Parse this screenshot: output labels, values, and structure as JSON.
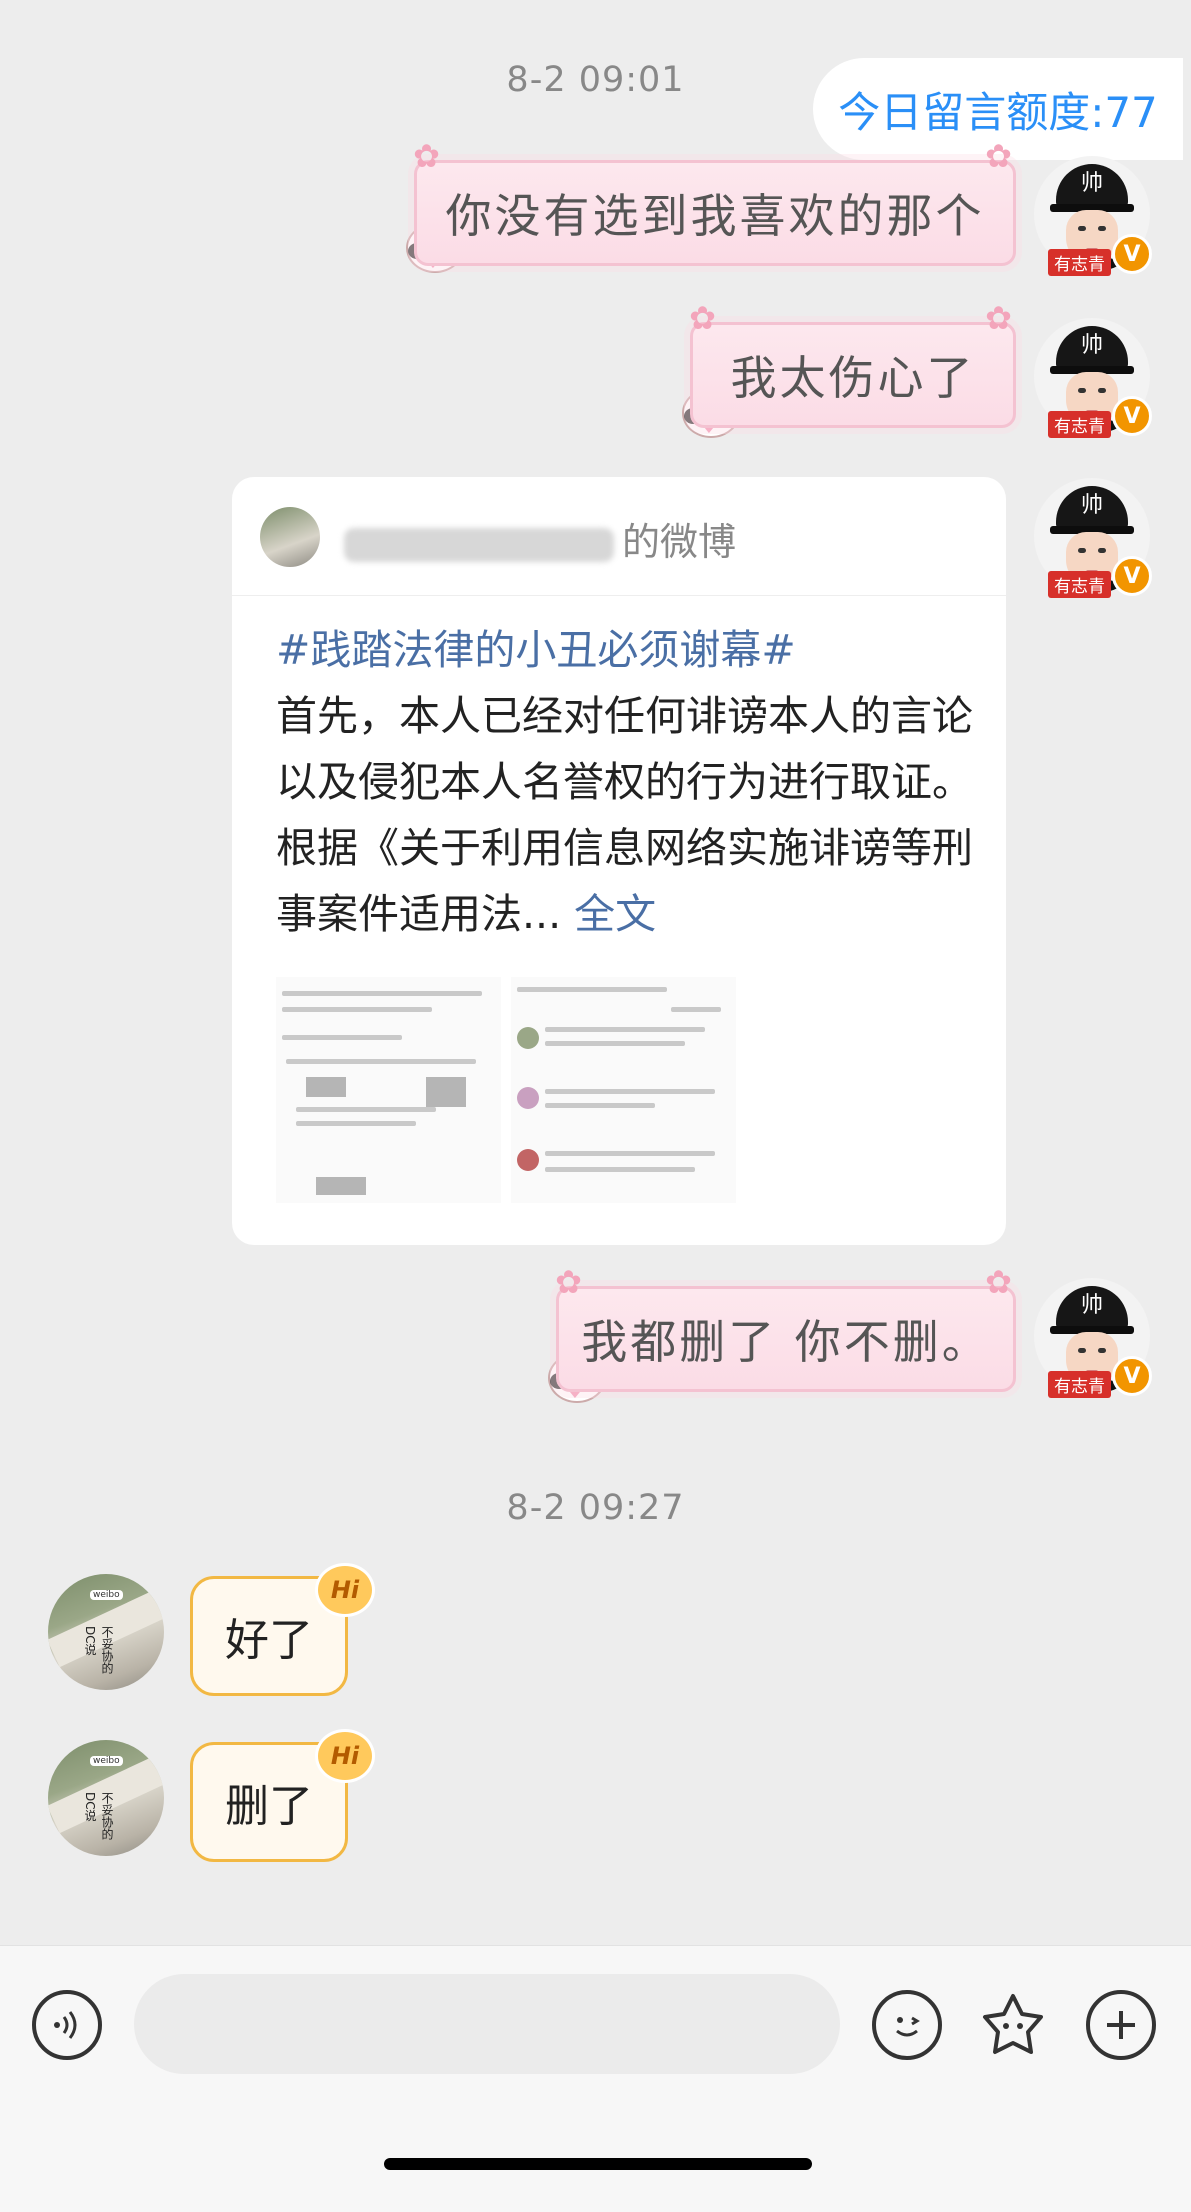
{
  "quota_label": "今日留言额度:77",
  "timestamps": [
    "8-2 09:01",
    "8-2 09:27"
  ],
  "avatar_tag": "有志青",
  "avatar_cap_text": "帅",
  "sent_messages": [
    "你没有选到我喜欢的那个",
    "我太伤心了",
    "我都删了 你不删。"
  ],
  "weibo_card": {
    "author_suffix": "的微博",
    "topic": "#践踏法律的小丑必须谢幕#",
    "text": "首先，本人已经对任何诽谤本人的言论以及侵犯本人名誉权的行为进行取证。根据《关于利用信息网络实施诽谤等刑事案件适用法...",
    "more_label": "全文"
  },
  "received_messages": [
    "好了",
    "删了"
  ],
  "hi_badge": "Hi",
  "colors": {
    "accent": "#2a8ff7",
    "link": "#4a6fa5",
    "bubble_border": "#f2b843",
    "sticker_bg": "#fde8ee"
  },
  "bottom_bar": {
    "voice_icon": "voice-icon",
    "emoji_icon": "emoji-icon",
    "sticker_icon": "sticker-icon",
    "add_icon": "plus-icon"
  }
}
